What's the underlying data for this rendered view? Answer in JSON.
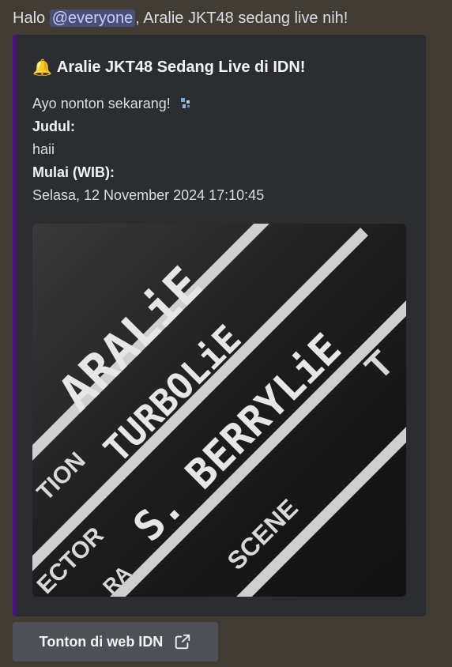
{
  "message": {
    "prefix": "Halo ",
    "mention": "@everyone",
    "suffix": ", Aralie JKT48 sedang live nih!"
  },
  "embed": {
    "accent_color": "#4b0f8c",
    "icon": "bell-icon",
    "title": "Aralie JKT48 Sedang Live di IDN!",
    "intro": "Ayo nonton sekarang!",
    "intro_icon": "sparkle-icon",
    "field_title_label": "Judul:",
    "field_title_value": "haii",
    "field_start_label": "Mulai (WIB):",
    "field_start_value": "Selasa, 12 November 2024 17:10:45",
    "image": {
      "board_text_1": "ARALiE",
      "board_text_2": "TURBOLiE",
      "board_text_3": "S. BERRYLiE",
      "label_1": "TION",
      "label_2": "ECTOR",
      "label_3": "SCENE",
      "label_4": "RA",
      "label_5": "T"
    }
  },
  "button": {
    "label": "Tonton di web IDN",
    "icon": "external-link-icon"
  }
}
